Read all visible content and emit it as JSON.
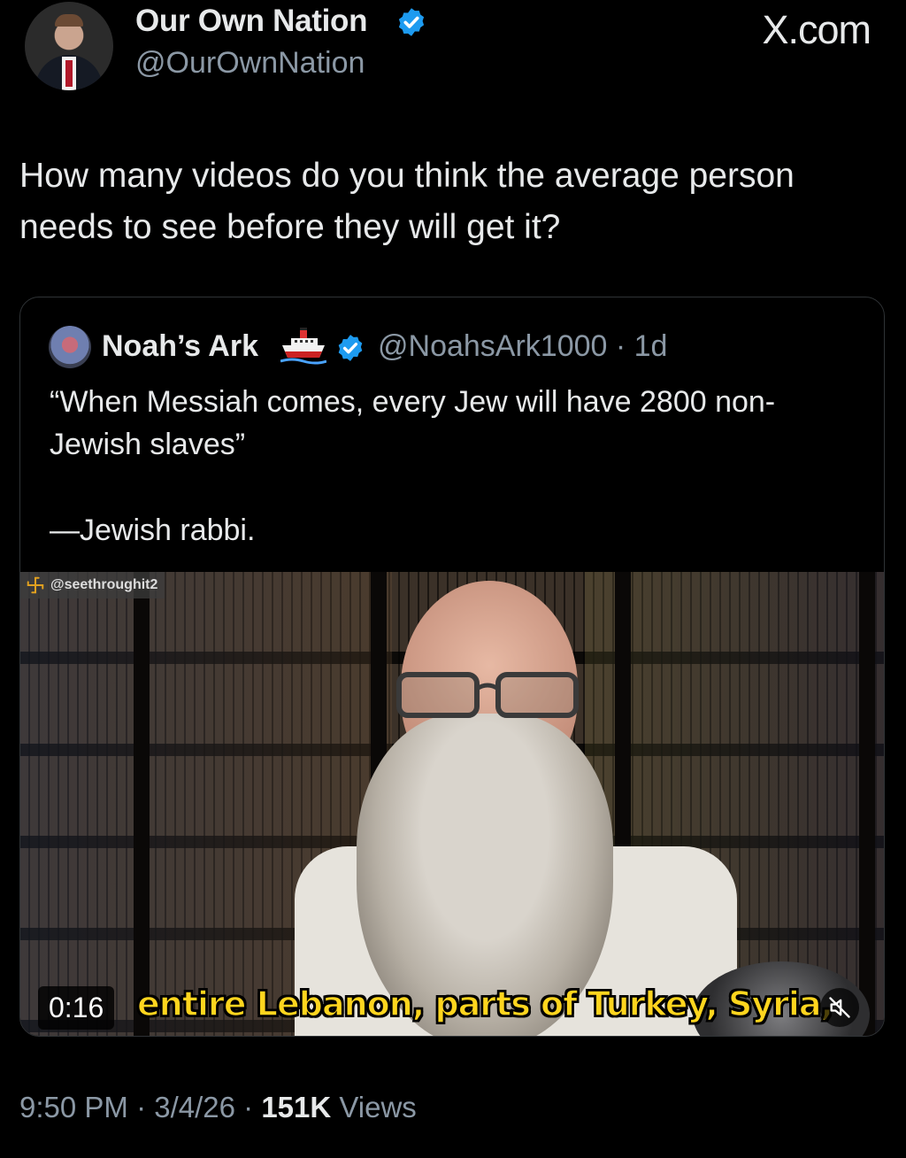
{
  "header": {
    "author_name": "Our Own Nation",
    "author_handle": "@OurOwnNation",
    "brand": "X.com"
  },
  "tweet": {
    "text": "How many videos do you think the average person needs to see before they will get it?"
  },
  "quoted": {
    "name": "Noah’s Ark",
    "handle_time": "@NoahsArk1000 · 1d",
    "text": "“When Messiah comes, every Jew will have 2800 non-Jewish slaves”",
    "attribution": "—Jewish rabbi.",
    "video": {
      "watermark": "@seethroughit2",
      "timecode": "0:16",
      "subtitle": "entire Lebanon, parts of Turkey, Syria,",
      "muted": true
    }
  },
  "footer": {
    "time_date": "9:50 PM · 3/4/26 · ",
    "views_count": "151K",
    "views_label": " Views"
  },
  "colors": {
    "background": "#000000",
    "text": "#e7e9ea",
    "secondary": "#8b98a5",
    "verified": "#1d9bf0",
    "subtitle": "#ffd51e"
  },
  "icons": [
    "verified-badge-icon",
    "ship-emoji-icon",
    "mute-icon",
    "watermark-logo-icon"
  ]
}
